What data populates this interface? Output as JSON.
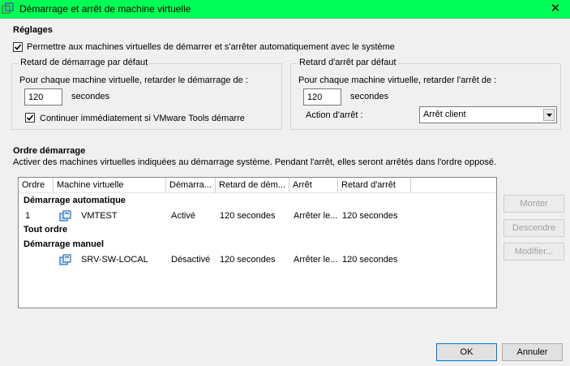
{
  "window": {
    "title": "Démarrage et arrêt de machine virtuelle",
    "close_glyph": "✕",
    "accent": "#00ff55"
  },
  "settings": {
    "heading": "Réglages",
    "auto_start_label": "Permettre aux machines virtuelles de démarrer et s'arrêter automatiquement avec le système",
    "auto_start_checked": true
  },
  "start_delay": {
    "legend": "Retard de démarrage par défaut",
    "description": "Pour chaque machine virtuelle, retarder le démarrage de :",
    "value": "120",
    "unit": "secondes",
    "continue_label": "Continuer immédiatement si VMware Tools démarre",
    "continue_checked": true
  },
  "stop_delay": {
    "legend": "Retard d'arrêt par défaut",
    "description": "Pour chaque machine virtuelle, retarder l'arrêt de :",
    "value": "120",
    "unit": "secondes",
    "action_label": "Action d'arrêt :",
    "action_value": "Arrêt client"
  },
  "startup_order": {
    "heading": "Ordre démarrage",
    "description": "Activer des machines virtuelles indiquées au démarrage système. Pendant l'arrêt, elles seront arrêtés dans l'ordre opposé.",
    "columns": [
      "Ordre",
      "Machine virtuelle",
      "Démarra...",
      "Retard de dém...",
      "Arrêt",
      "Retard d'arrêt"
    ],
    "groups": {
      "auto": "Démarrage automatique",
      "any": "Tout ordre",
      "manual": "Démarrage manuel"
    },
    "rows": [
      {
        "order": "1",
        "vm": "VMTEST",
        "startup": "Activé",
        "start_delay": "120 secondes",
        "stop": "Arrêter le...",
        "stop_delay": "120 secondes"
      },
      {
        "order": "",
        "vm": "SRV-SW-LOCAL",
        "startup": "Désactivé",
        "start_delay": "120 secondes",
        "stop": "Arrêter le...",
        "stop_delay": "120 secondes"
      }
    ]
  },
  "side_buttons": {
    "up": "Monter",
    "down": "Descendre",
    "edit": "Modifier..."
  },
  "footer": {
    "ok": "OK",
    "cancel": "Annuler"
  }
}
